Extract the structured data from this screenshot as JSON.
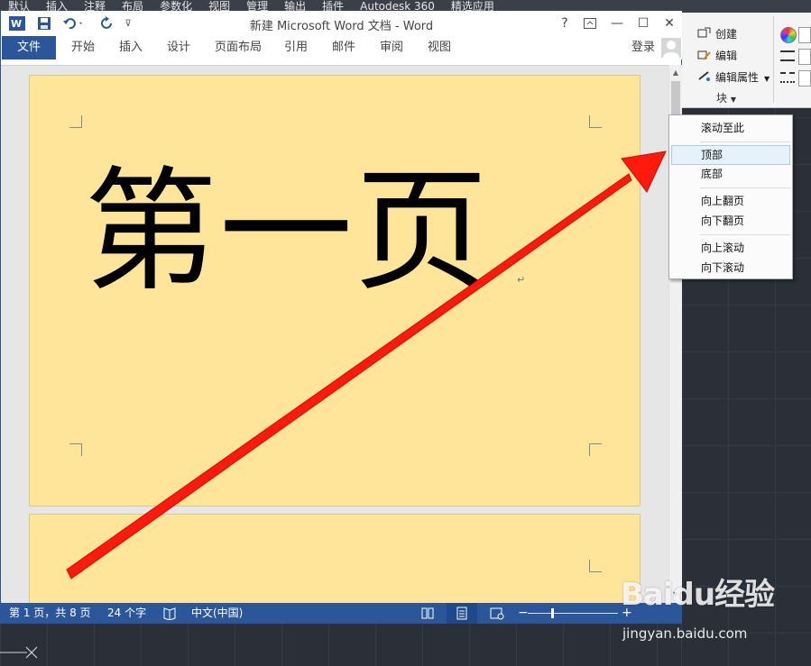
{
  "autocad": {
    "top_tabs": [
      "默认",
      "插入",
      "注释",
      "布局",
      "参数化",
      "视图",
      "管理",
      "输出",
      "插件",
      "Autodesk 360",
      "精选应用"
    ],
    "block_panel": {
      "items": [
        "创建",
        "编辑",
        "编辑属性"
      ],
      "title": "块"
    }
  },
  "word": {
    "title": "新建 Microsoft Word 文档 - Word",
    "qat": {
      "help": "?",
      "min": "—",
      "max": "☐",
      "close": "✕"
    },
    "menu": {
      "file": "文件",
      "tabs": [
        "开始",
        "插入",
        "设计",
        "页面布局",
        "引用",
        "邮件",
        "审阅",
        "视图"
      ],
      "login": "登录"
    },
    "document": {
      "page1_text": "第一页",
      "para_mark": "↵"
    },
    "status": {
      "page": "第 1 页，共 8 页",
      "words": "24 个字",
      "language": "中文(中国)",
      "zoom_level": 0.27
    }
  },
  "context_menu": {
    "items": [
      "滚动至此",
      "顶部",
      "底部",
      "向上翻页",
      "向下翻页",
      "向上滚动",
      "向下滚动"
    ],
    "highlighted": "顶部"
  },
  "watermark": {
    "brand": "Baidu经验",
    "url": "jingyan.baidu.com"
  },
  "colors": {
    "word_blue": "#2b579a",
    "page_fill": "#ffe599",
    "arrow_red": "#ff1a0e",
    "cad_bg": "#2b2f38"
  }
}
